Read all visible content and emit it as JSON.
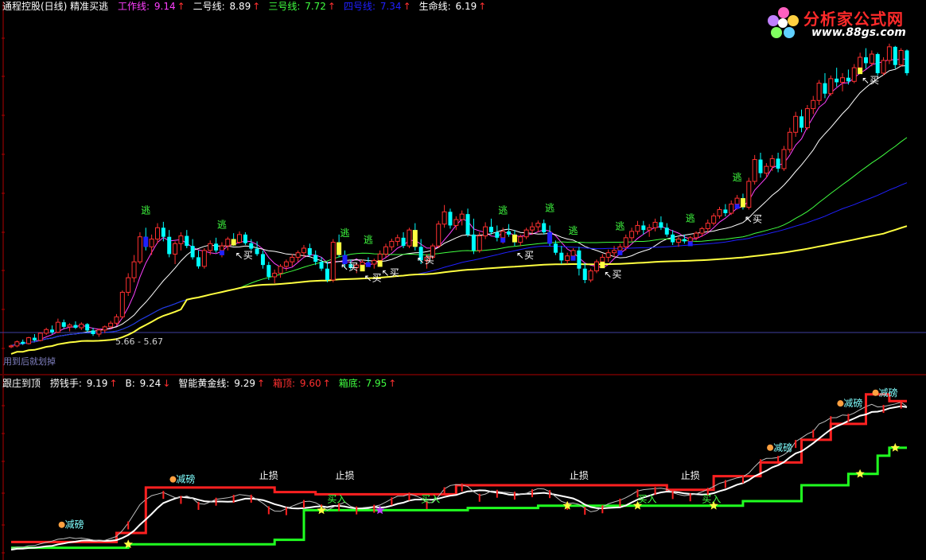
{
  "header_top": {
    "title": "通程控股(日线) 精准买逃",
    "items": [
      {
        "label": "工作线:",
        "value": "9.14",
        "color": "#ff40ff",
        "arrow": "↑"
      },
      {
        "label": "二号线:",
        "value": "8.89",
        "color": "#ffffff",
        "arrow": "↑"
      },
      {
        "label": "三号线:",
        "value": "7.72",
        "color": "#40ff40",
        "arrow": "↑"
      },
      {
        "label": "四号线:",
        "value": "7.34",
        "color": "#2020ff",
        "arrow": "↑"
      },
      {
        "label": "生命线:",
        "value": "6.19",
        "color": "#ffffff",
        "arrow": "↑"
      }
    ]
  },
  "header_bottom": {
    "title": "跟庄到顶",
    "items": [
      {
        "label": "捞钱手:",
        "value": "9.19",
        "color": "#ffffff",
        "arrow": "↑"
      },
      {
        "label": "B:",
        "value": "9.24",
        "color": "#ffffff",
        "arrow": "↓"
      },
      {
        "label": "智能黄金线:",
        "value": "9.29",
        "color": "#ffffff",
        "arrow": "↑"
      },
      {
        "label": "箱顶:",
        "value": "9.60",
        "color": "#ff3030",
        "arrow": "↑"
      },
      {
        "label": "箱底:",
        "value": "7.95",
        "color": "#40ff40",
        "arrow": "↑"
      }
    ]
  },
  "logo": {
    "title": "分析家公式网",
    "url": "www.88gs.com"
  },
  "price_label": "5.66 - 5.67",
  "tool_label": "用到后就划掉",
  "colors": {
    "up": "#ff3030",
    "down": "#00ffff",
    "escape": "#40ff40",
    "buy": "#ffffff",
    "gridline": "#800000",
    "gold": "#ffff40",
    "box_top": "#ff2020",
    "box_bottom": "#20ff20"
  },
  "chart_data": {
    "type": "candlestick",
    "candles": [
      [
        5.58,
        5.63,
        5.55,
        5.6
      ],
      [
        5.6,
        5.72,
        5.57,
        5.69
      ],
      [
        5.69,
        5.74,
        5.62,
        5.65
      ],
      [
        5.65,
        5.8,
        5.63,
        5.78
      ],
      [
        5.78,
        5.86,
        5.7,
        5.72
      ],
      [
        5.72,
        5.9,
        5.7,
        5.88
      ],
      [
        5.88,
        6.0,
        5.84,
        5.96
      ],
      [
        5.96,
        6.05,
        5.86,
        5.9
      ],
      [
        5.9,
        6.2,
        5.88,
        6.12
      ],
      [
        6.12,
        6.18,
        5.98,
        6.02
      ],
      [
        6.02,
        6.1,
        5.92,
        6.06
      ],
      [
        6.06,
        6.14,
        5.97,
        6.0
      ],
      [
        6.0,
        6.12,
        5.95,
        6.08
      ],
      [
        6.08,
        6.1,
        5.9,
        5.94
      ],
      [
        5.94,
        6.0,
        5.82,
        5.86
      ],
      [
        5.86,
        5.98,
        5.8,
        5.95
      ],
      [
        5.95,
        6.05,
        5.88,
        6.02
      ],
      [
        6.02,
        6.15,
        5.98,
        6.1
      ],
      [
        6.1,
        6.3,
        6.05,
        6.24
      ],
      [
        6.24,
        6.82,
        6.2,
        6.78
      ],
      [
        6.78,
        7.2,
        6.7,
        7.1
      ],
      [
        7.1,
        7.6,
        7.0,
        7.45
      ],
      [
        7.45,
        8.1,
        7.4,
        8.0
      ],
      [
        8.0,
        8.2,
        7.7,
        7.78
      ],
      [
        7.78,
        8.05,
        7.6,
        7.95
      ],
      [
        7.95,
        8.3,
        7.85,
        8.2
      ],
      [
        8.2,
        8.33,
        7.9,
        8.0
      ],
      [
        8.0,
        8.15,
        7.55,
        7.62
      ],
      [
        7.62,
        7.9,
        7.4,
        7.85
      ],
      [
        7.85,
        8.1,
        7.7,
        8.02
      ],
      [
        8.02,
        8.15,
        7.75,
        7.8
      ],
      [
        7.8,
        7.95,
        7.5,
        7.55
      ],
      [
        7.55,
        7.7,
        7.3,
        7.35
      ],
      [
        7.35,
        7.75,
        7.3,
        7.7
      ],
      [
        7.7,
        7.92,
        7.6,
        7.85
      ],
      [
        7.85,
        7.98,
        7.65,
        7.7
      ],
      [
        7.7,
        7.88,
        7.55,
        7.8
      ],
      [
        7.8,
        8.0,
        7.7,
        7.95
      ],
      [
        7.95,
        8.08,
        7.8,
        7.88
      ],
      [
        7.88,
        8.12,
        7.85,
        8.05
      ],
      [
        8.05,
        8.1,
        7.82,
        7.86
      ],
      [
        7.86,
        7.95,
        7.7,
        7.74
      ],
      [
        7.74,
        7.9,
        7.58,
        7.62
      ],
      [
        7.62,
        7.7,
        7.3,
        7.38
      ],
      [
        7.38,
        7.45,
        7.05,
        7.12
      ],
      [
        7.12,
        7.28,
        6.98,
        7.2
      ],
      [
        7.2,
        7.4,
        7.1,
        7.35
      ],
      [
        7.35,
        7.5,
        7.25,
        7.45
      ],
      [
        7.45,
        7.62,
        7.35,
        7.55
      ],
      [
        7.55,
        7.7,
        7.45,
        7.65
      ],
      [
        7.65,
        7.82,
        7.55,
        7.75
      ],
      [
        7.75,
        7.85,
        7.55,
        7.6
      ],
      [
        7.6,
        7.7,
        7.38,
        7.45
      ],
      [
        7.45,
        7.55,
        7.25,
        7.3
      ],
      [
        7.3,
        7.45,
        7.0,
        7.05
      ],
      [
        7.05,
        7.95,
        7.0,
        7.88
      ],
      [
        7.88,
        8.05,
        7.55,
        7.6
      ],
      [
        7.6,
        7.7,
        7.32,
        7.4
      ],
      [
        7.4,
        7.5,
        7.28,
        7.32
      ],
      [
        7.32,
        7.42,
        7.2,
        7.38
      ],
      [
        7.38,
        7.5,
        7.3,
        7.44
      ],
      [
        7.44,
        7.55,
        7.35,
        7.4
      ],
      [
        7.4,
        7.52,
        7.3,
        7.48
      ],
      [
        7.48,
        7.7,
        7.42,
        7.62
      ],
      [
        7.62,
        7.85,
        7.55,
        7.78
      ],
      [
        7.78,
        7.96,
        7.7,
        7.9
      ],
      [
        7.9,
        8.05,
        7.8,
        7.98
      ],
      [
        7.98,
        8.1,
        7.75,
        7.8
      ],
      [
        7.8,
        8.2,
        7.75,
        8.15
      ],
      [
        8.15,
        8.3,
        7.7,
        7.78
      ],
      [
        7.78,
        7.95,
        7.4,
        7.48
      ],
      [
        7.48,
        7.62,
        7.3,
        7.55
      ],
      [
        7.55,
        7.85,
        7.5,
        7.8
      ],
      [
        7.8,
        8.35,
        7.75,
        8.28
      ],
      [
        8.28,
        8.7,
        8.2,
        8.55
      ],
      [
        8.55,
        8.62,
        8.18,
        8.25
      ],
      [
        8.25,
        8.45,
        8.15,
        8.38
      ],
      [
        8.38,
        8.58,
        8.25,
        8.5
      ],
      [
        8.5,
        8.62,
        8.0,
        8.05
      ],
      [
        8.05,
        8.4,
        7.62,
        7.7
      ],
      [
        7.7,
        8.1,
        7.65,
        8.02
      ],
      [
        8.02,
        8.32,
        7.95,
        8.22
      ],
      [
        8.22,
        8.4,
        8.05,
        8.1
      ],
      [
        8.1,
        8.25,
        7.9,
        7.98
      ],
      [
        7.98,
        8.2,
        7.85,
        8.12
      ],
      [
        8.12,
        8.28,
        8.0,
        8.05
      ],
      [
        8.05,
        8.15,
        7.8,
        7.88
      ],
      [
        7.88,
        8.05,
        7.8,
        8.0
      ],
      [
        8.0,
        8.2,
        7.95,
        8.15
      ],
      [
        8.15,
        8.32,
        8.05,
        8.22
      ],
      [
        8.22,
        8.36,
        8.1,
        8.3
      ],
      [
        8.3,
        8.38,
        8.05,
        8.1
      ],
      [
        8.1,
        8.25,
        7.8,
        7.85
      ],
      [
        7.85,
        7.92,
        7.6,
        7.65
      ],
      [
        7.65,
        7.8,
        7.4,
        7.48
      ],
      [
        7.48,
        7.65,
        7.4,
        7.58
      ],
      [
        7.58,
        7.75,
        7.5,
        7.7
      ],
      [
        7.7,
        7.78,
        7.15,
        7.3
      ],
      [
        7.3,
        7.42,
        6.98,
        7.05
      ],
      [
        7.05,
        7.3,
        7.0,
        7.25
      ],
      [
        7.25,
        7.5,
        7.2,
        7.45
      ],
      [
        7.45,
        7.62,
        7.38,
        7.55
      ],
      [
        7.55,
        7.72,
        7.45,
        7.65
      ],
      [
        7.65,
        7.8,
        7.55,
        7.7
      ],
      [
        7.7,
        7.85,
        7.6,
        7.78
      ],
      [
        7.78,
        8.05,
        7.7,
        7.98
      ],
      [
        7.98,
        8.2,
        7.9,
        8.12
      ],
      [
        8.12,
        8.35,
        8.05,
        8.25
      ],
      [
        8.25,
        8.35,
        8.05,
        8.15
      ],
      [
        8.15,
        8.28,
        8.0,
        8.2
      ],
      [
        8.2,
        8.4,
        8.12,
        8.32
      ],
      [
        8.32,
        8.45,
        8.15,
        8.2
      ],
      [
        8.2,
        8.3,
        8.0,
        8.05
      ],
      [
        8.05,
        8.15,
        7.82,
        7.88
      ],
      [
        7.88,
        8.0,
        7.78,
        7.95
      ],
      [
        7.95,
        8.05,
        7.85,
        7.9
      ],
      [
        7.9,
        8.02,
        7.82,
        7.98
      ],
      [
        7.98,
        8.12,
        7.92,
        8.08
      ],
      [
        8.08,
        8.22,
        8.0,
        8.18
      ],
      [
        8.18,
        8.38,
        8.1,
        8.3
      ],
      [
        8.3,
        8.52,
        8.25,
        8.46
      ],
      [
        8.46,
        8.66,
        8.4,
        8.6
      ],
      [
        8.6,
        8.72,
        8.45,
        8.52
      ],
      [
        8.52,
        8.8,
        8.48,
        8.72
      ],
      [
        8.72,
        8.92,
        8.6,
        8.85
      ],
      [
        8.85,
        8.95,
        8.6,
        8.65
      ],
      [
        8.65,
        9.3,
        8.6,
        9.22
      ],
      [
        9.22,
        9.8,
        9.15,
        9.7
      ],
      [
        9.7,
        9.85,
        9.3,
        9.4
      ],
      [
        9.4,
        9.62,
        9.3,
        9.55
      ],
      [
        9.55,
        9.8,
        9.45,
        9.72
      ],
      [
        9.72,
        9.85,
        9.42,
        9.5
      ],
      [
        9.5,
        10.0,
        9.45,
        9.92
      ],
      [
        9.92,
        10.4,
        9.85,
        10.3
      ],
      [
        10.3,
        10.75,
        10.2,
        10.65
      ],
      [
        10.65,
        10.8,
        10.3,
        10.4
      ],
      [
        10.4,
        10.9,
        10.35,
        10.82
      ],
      [
        10.82,
        11.1,
        10.7,
        11.0
      ],
      [
        11.0,
        11.45,
        10.9,
        11.38
      ],
      [
        11.38,
        11.6,
        11.05,
        11.15
      ],
      [
        11.15,
        11.55,
        11.1,
        11.48
      ],
      [
        11.48,
        11.72,
        11.3,
        11.4
      ],
      [
        11.4,
        11.6,
        11.2,
        11.5
      ],
      [
        11.5,
        11.68,
        11.35,
        11.42
      ],
      [
        11.42,
        11.8,
        11.38,
        11.72
      ],
      [
        11.72,
        12.05,
        11.65,
        11.95
      ],
      [
        11.95,
        12.15,
        11.7,
        11.82
      ],
      [
        11.82,
        12.1,
        11.75,
        12.02
      ],
      [
        12.02,
        12.05,
        11.55,
        11.6
      ],
      [
        11.6,
        11.95,
        11.55,
        11.88
      ],
      [
        11.88,
        12.25,
        11.8,
        12.18
      ],
      [
        12.18,
        12.2,
        11.7,
        11.78
      ],
      [
        11.78,
        12.15,
        11.75,
        12.1
      ],
      [
        12.1,
        12.12,
        11.55,
        11.6
      ]
    ],
    "escape_signals": [
      23,
      36,
      57,
      61,
      84,
      92,
      96,
      104,
      116,
      124
    ],
    "buy_signals": [
      38,
      56,
      60,
      63,
      69,
      86,
      101,
      125,
      145
    ],
    "lines": {
      "工作线": {
        "color": "#ff40ff"
      },
      "二号线": {
        "color": "#ffffff"
      },
      "三号线": {
        "color": "#40ff40"
      },
      "四号线": {
        "color": "#2020ff"
      },
      "生命线": {
        "color": "#ffff40"
      }
    },
    "lower": {
      "box_top_segments": [
        [
          0,
          5.8
        ],
        [
          18,
          6.2
        ],
        [
          23,
          8.2
        ],
        [
          45,
          8.0
        ],
        [
          52,
          7.9
        ],
        [
          76,
          8.3
        ],
        [
          112,
          8.1
        ],
        [
          120,
          8.7
        ],
        [
          128,
          9.3
        ],
        [
          135,
          10.3
        ],
        [
          140,
          11.0
        ],
        [
          146,
          12.3
        ],
        [
          150,
          12.0
        ]
      ],
      "box_bottom_segments": [
        [
          0,
          5.55
        ],
        [
          20,
          5.7
        ],
        [
          45,
          5.9
        ],
        [
          50,
          7.2
        ],
        [
          78,
          7.3
        ],
        [
          90,
          7.4
        ],
        [
          125,
          7.6
        ],
        [
          135,
          8.3
        ],
        [
          143,
          8.8
        ],
        [
          148,
          9.6
        ],
        [
          150,
          9.95
        ]
      ],
      "stop_loss_labels": [
        [
          44,
          "止损"
        ],
        [
          57,
          "止损"
        ],
        [
          97,
          "止损"
        ],
        [
          116,
          "止损"
        ]
      ],
      "reduce_labels": [
        [
          10,
          "减磅"
        ],
        [
          29,
          "减磅"
        ],
        [
          131,
          "减磅"
        ],
        [
          143,
          "减磅"
        ],
        [
          149,
          "减磅"
        ]
      ],
      "buy_in_labels": [
        [
          54,
          "买入"
        ],
        [
          70,
          "买入"
        ],
        [
          107,
          "买入"
        ],
        [
          118,
          "买入"
        ]
      ],
      "stars": [
        20,
        53,
        63,
        95,
        107,
        120,
        145,
        151
      ],
      "star_colors": {
        "default": "#ffff40",
        "special": "#c040ff"
      }
    }
  }
}
